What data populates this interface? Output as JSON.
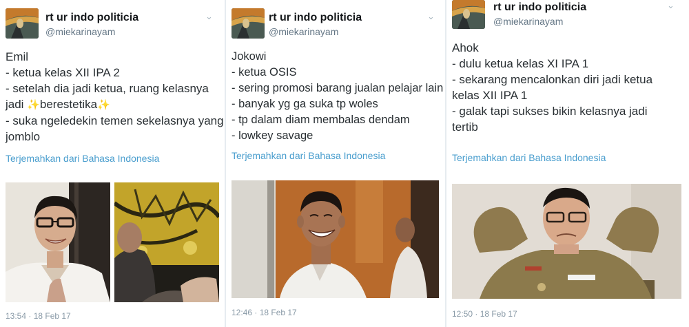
{
  "tweets": [
    {
      "name": "rt ur indo politicia",
      "handle": "@miekarinayam",
      "lines": [
        "Emil",
        "- ketua kelas XII IPA 2",
        "- setelah dia jadi ketua, ruang kelasnya",
        [
          "jadi ",
          "✨",
          "berestetika",
          "✨"
        ],
        "- suka ngeledekin temen sekelasnya yang",
        "jomblo"
      ],
      "translate": "Terjemahkan dari Bahasa Indonesia",
      "timestamp": "13:54 · 18 Feb 17"
    },
    {
      "name": "rt ur indo politicia",
      "handle": "@miekarinayam",
      "lines": [
        "Jokowi",
        "- ketua OSIS",
        "- sering promosi barang jualan pelajar lain",
        "- banyak yg ga suka tp woles",
        "- tp dalam diam membalas dendam",
        "- lowkey savage"
      ],
      "translate": "Terjemahkan dari Bahasa Indonesia",
      "timestamp": "12:46 · 18 Feb 17"
    },
    {
      "name": "rt ur indo politicia",
      "handle": "@miekarinayam",
      "lines": [
        "Ahok",
        "- dulu ketua kelas XI IPA 1",
        "- sekarang mencalonkan diri jadi ketua",
        "kelas XII IPA 1",
        "- galak tapi sukses bikin kelasnya jadi",
        "tertib"
      ],
      "translate": "Terjemahkan dari Bahasa Indonesia",
      "timestamp": "12:50 · 18 Feb 17"
    }
  ],
  "icons": {
    "menu": "chevron-down-icon",
    "avatar": "scream-painting-avatar",
    "sparkle": "sparkles-icon"
  },
  "colors": {
    "translate_link": "#4a9ece",
    "meta_gray": "#657786",
    "timestamp_gray": "#8899a6"
  }
}
